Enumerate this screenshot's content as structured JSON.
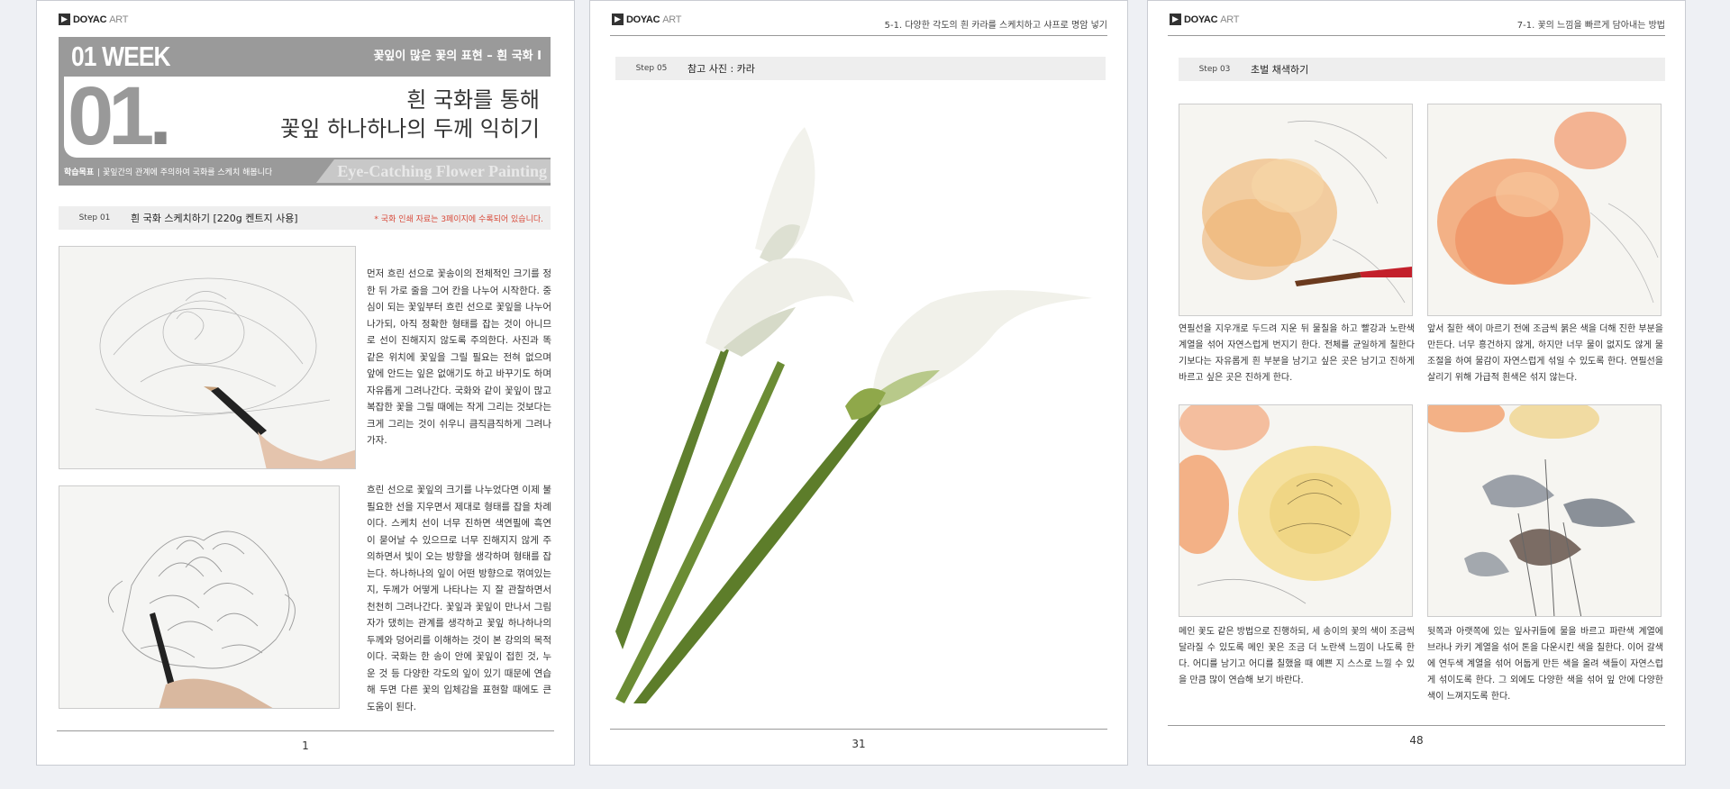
{
  "brand": {
    "name_bold": "DOYAC",
    "name_light": "ART"
  },
  "pages": [
    {
      "week_label": "01 WEEK",
      "banner_subtitle": "꽃잎이 많은 꽃의 표현 – 흰 국화 I",
      "lesson_number": "01",
      "title_line1": "흰 국화를 통해",
      "title_line2": "꽃잎 하나하나의 두께 익히기",
      "goal_label": "학습목표",
      "goal_text": "|  꽃잎간의 관계에 주의하여 국화를 스케치 해봅니다",
      "eyecatch": "Eye-Catching Flower Painting",
      "step": {
        "tag": "Step 01",
        "title": "흰 국화 스케치하기 [220g 켄트지 사용]",
        "note": "* 국화 인쇄 자료는 3페이지에 수록되어 있습니다."
      },
      "para1": "먼저 흐린 선으로 꽃송이의 전체적인 크기를 정한 뒤 가로 줄을 그어 칸을 나누어 시작한다. 중심이 되는 꽃잎부터 흐린 선으로 꽃잎을 나누어 나가되, 아직 정확한 형태를 잡는 것이 아니므로 선이 진해지지 않도록 주의한다. 사진과 똑같은 위치에 꽃잎을 그릴 필요는 전혀 없으며 앞에 안드는 잎은 없애기도 하고 바꾸기도 하며 자유롭게 그려나간다. 국화와 같이 꽃잎이 많고 복잡한 꽃을 그릴 때에는 작게 그리는 것보다는 크게 그리는 것이 쉬우니 큼직큼직하게 그려나가자.",
      "para2": "흐린 선으로 꽃잎의 크기를 나누었다면 이제 불필요한 선을 지우면서 제대로 형태를 잡을 차례이다. 스케치 선이 너무 진하면 색연필에 흑연이 묻어날 수 있으므로 너무 진해지지 않게 주의하면서 빛이 오는 방향을 생각하며 형태를 잡는다. 하나하나의 잎이 어떤 방향으로 꺾여있는 지, 두께가 어떻게 나타나는 지 잘 관찰하면서 천천히 그려나간다. 꽃잎과 꽃잎이 만나서 그림자가 댔히는 관계를 생각하고 꽃잎 하나하나의 두께와 덩어리를 이해하는 것이 본 강의의 목적이다. 국화는 한 송이 안에 꽃잎이 접힌 것, 누운 것 등 다양한 각도의 잎이 있기 때문에 연습해 두면 다른 꽃의 입체감을 표현할 때에도 큰 도움이 된다.",
      "page_number": "1"
    },
    {
      "header": "5-1. 다양한 각도의 흰 카라를 스케치하고 샤프로 명암 넣기",
      "step": {
        "tag": "Step 05",
        "title": "참고 사진 : 카라"
      },
      "page_number": "31"
    },
    {
      "header": "7-1. 꽃의 느낌을 빠르게 담아내는 방법",
      "step": {
        "tag": "Step 03",
        "title": "초벌 채색하기"
      },
      "captions": [
        "연필선을 지우개로 두드려 지운 뒤 물칠을 하고 빨강과 노란색 계열을 섞어 자연스럽게 번지기 한다. 전체를 균일하게 칠한다기보다는 자유롭게 흰 부분을 남기고 싶은 곳은 남기고 진하게 바르고 싶은 곳은 진하게 한다.",
        "앞서 칠한 색이 마르기 전에 조금씩 붉은 색을 더해 진한 부분을 만든다. 너무 흥건하지 않게, 하지만 너무 물이 없지도 않게 물 조절을 하여 물감이 자연스럽게 섞일 수 있도록 한다. 연필선을 살리기 위해 가급적 흰색은 섞지 않는다.",
        "메인 꽃도 같은 방법으로 진행하되, 세 송이의 꽃의 색이 조금씩 달라질 수 있도록 메인 꽃은 조금 더 노란색 느낌이 나도록 한다. 어디를 남기고 어디를 칠했을 때 예쁜 지 스스로 느낄 수 있을 만큼 많이 연습해 보기 바란다.",
        "뒷쪽과 아랫쪽에 있는 잎사귀들에 물을 바르고 파란색 계열에 브라나 카키 계열을 섞어 톤을 다운시킨 색을 칠한다. 이어 갈색에 연두색 계열을 섞어 어둡게 만든 색을 올려 색들이 자연스럽게 섞이도록 한다. 그 외에도 다양한 색을 섞어 잎 안에 다양한 색이 느껴지도록 한다."
      ],
      "page_number": "48"
    }
  ]
}
